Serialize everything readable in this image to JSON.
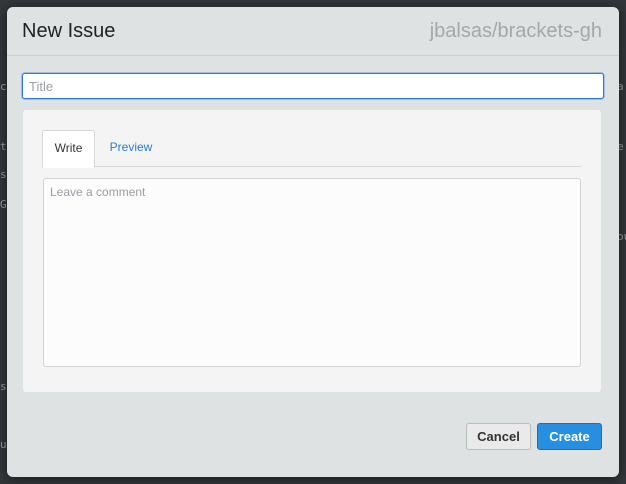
{
  "modal": {
    "title": "New Issue",
    "repo": "jbalsas/brackets-gh"
  },
  "form": {
    "title_placeholder": "Title",
    "title_value": "",
    "tabs": [
      {
        "label": "Write",
        "active": true
      },
      {
        "label": "Preview",
        "active": false
      }
    ],
    "comment_placeholder": "Leave a comment",
    "comment_value": ""
  },
  "actions": {
    "cancel_label": "Cancel",
    "create_label": "Create"
  },
  "backdrop": {
    "fragments": [
      "c",
      "t",
      "s",
      "G",
      "f",
      "s",
      "u",
      "a",
      "e",
      "ou"
    ]
  },
  "colors": {
    "accent": "#288edf",
    "link": "#2b7cd6",
    "modal_bg": "#dfe2e2",
    "panel_bg": "#f4f4f4"
  }
}
